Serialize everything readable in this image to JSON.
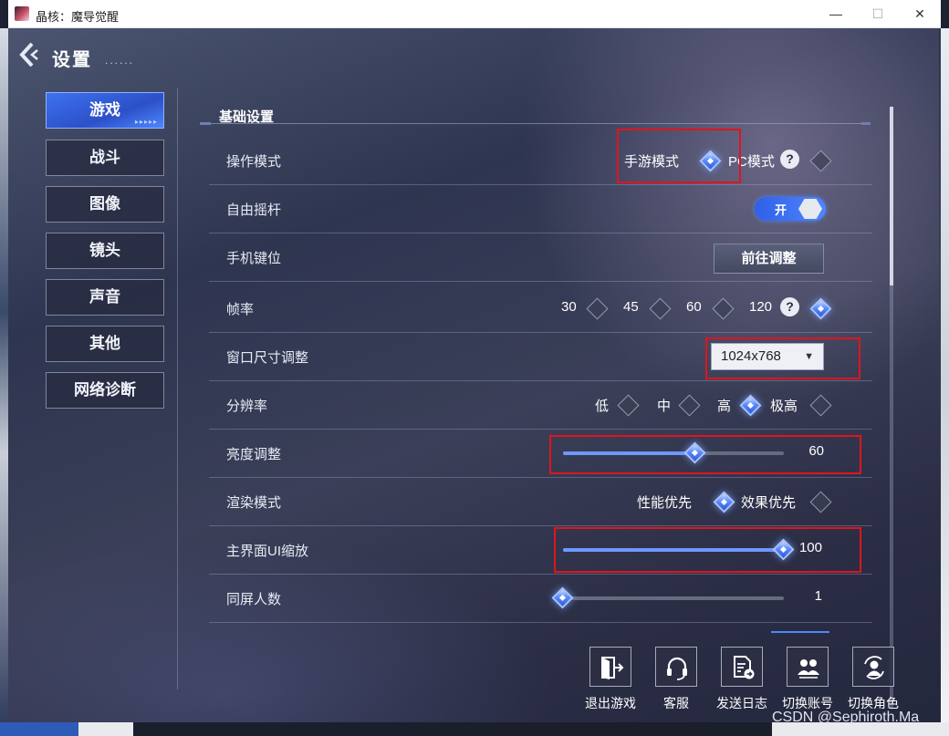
{
  "window": {
    "title": "晶核：魔导觉醒",
    "controls": {
      "minimize": "—",
      "maximize": "☐",
      "close": "✕"
    }
  },
  "header": {
    "back_icon": "back-arrow-icon",
    "title": "设置",
    "subtitle_dots": "......"
  },
  "nav": {
    "items": [
      {
        "label": "游戏",
        "active": true
      },
      {
        "label": "战斗"
      },
      {
        "label": "图像"
      },
      {
        "label": "镜头"
      },
      {
        "label": "声音"
      },
      {
        "label": "其他"
      },
      {
        "label": "网络诊断"
      }
    ]
  },
  "section": {
    "title": "基础设置"
  },
  "rows": {
    "operation_mode": {
      "label": "操作模式",
      "options": [
        {
          "label": "手游模式",
          "selected": true
        },
        {
          "label": "PC模式",
          "selected": false
        }
      ],
      "help": "?"
    },
    "joystick": {
      "label": "自由摇杆",
      "toggle_label": "开",
      "on": true
    },
    "key_layout": {
      "label": "手机键位",
      "button": "前往调整"
    },
    "frame_rate": {
      "label": "帧率",
      "options": [
        {
          "label": "30",
          "selected": false
        },
        {
          "label": "45",
          "selected": false
        },
        {
          "label": "60",
          "selected": false
        },
        {
          "label": "120",
          "selected": true
        }
      ],
      "help": "?"
    },
    "window_size": {
      "label": "窗口尺寸调整",
      "value": "1024x768",
      "caret": "▼"
    },
    "resolution": {
      "label": "分辨率",
      "options": [
        {
          "label": "低",
          "selected": false
        },
        {
          "label": "中",
          "selected": false
        },
        {
          "label": "高",
          "selected": true
        },
        {
          "label": "极高",
          "selected": false
        }
      ]
    },
    "brightness": {
      "label": "亮度调整",
      "value": "60",
      "fraction": 0.6
    },
    "render_mode": {
      "label": "渲染模式",
      "options": [
        {
          "label": "性能优先",
          "selected": true
        },
        {
          "label": "效果优先",
          "selected": false
        }
      ]
    },
    "ui_scale": {
      "label": "主界面UI缩放",
      "value": "100",
      "fraction": 1.0
    },
    "players_on_screen": {
      "label": "同屏人数",
      "value": "1",
      "fraction": 0.0
    }
  },
  "actions": [
    {
      "label": "退出游戏",
      "icon": "exit-icon"
    },
    {
      "label": "客服",
      "icon": "headset-icon"
    },
    {
      "label": "发送日志",
      "icon": "send-log-icon"
    },
    {
      "label": "切换账号",
      "icon": "switch-account-icon"
    },
    {
      "label": "切换角色",
      "icon": "switch-character-icon"
    }
  ],
  "watermark": "CSDN @Sephiroth.Ma",
  "colors": {
    "accent": "#4f86ff",
    "highlight_box": "#e0141e",
    "panel_bg": "#2e3550"
  }
}
